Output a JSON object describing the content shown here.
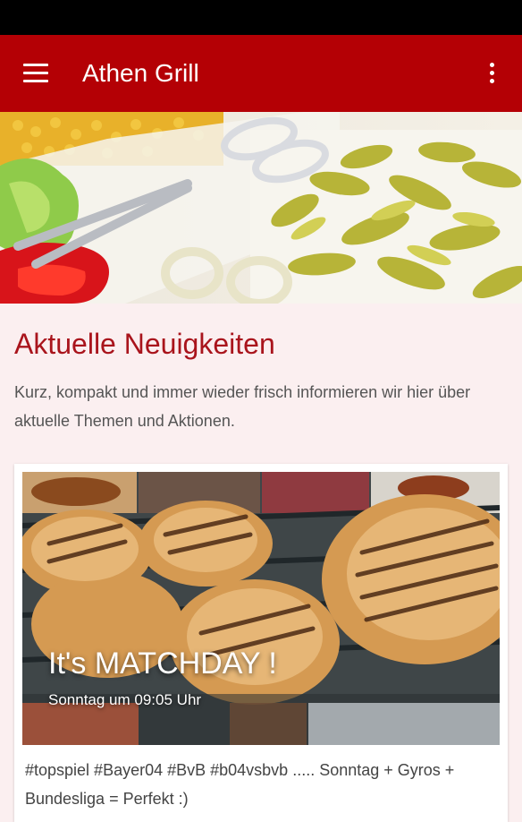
{
  "app": {
    "title": "Athen Grill"
  },
  "icons": {
    "menu": "hamburger-menu-icon",
    "overflow": "more-vert-icon"
  },
  "colors": {
    "appbar": "#b40005",
    "accent": "#a9141c",
    "background": "#fbeff0"
  },
  "news": {
    "heading": "Aktuelle Neuigkeiten",
    "description": "Kurz, kompakt und immer wieder frisch informieren wir hier über aktuelle Themen und Aktionen.",
    "post": {
      "title": "It's MATCHDAY !",
      "date": "Sonntag um 09:05 Uhr",
      "text": "#topspiel #Bayer04 #BvB #b04vsbvb ..... Sonntag + Gyros + Bundesliga = Perfekt :)"
    }
  }
}
